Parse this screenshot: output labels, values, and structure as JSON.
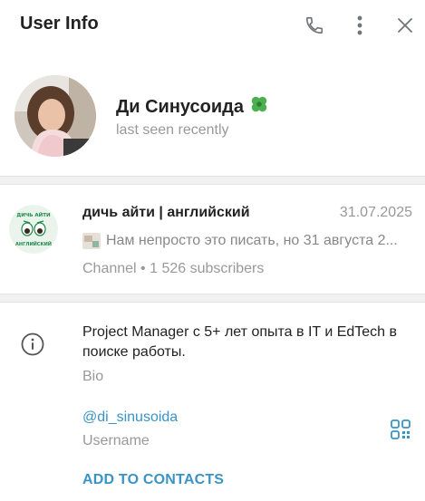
{
  "header": {
    "title": "User Info",
    "call_icon": "phone-icon",
    "more_icon": "more-vertical-icon",
    "close_icon": "close-icon"
  },
  "profile": {
    "name": "Ди Синусоида",
    "emoji_status": "🍀",
    "status": "last seen recently"
  },
  "channel": {
    "title": "дичь айти | английский",
    "date": "31.07.2025",
    "last_message": "Нам непросто это писать, но 31 августа 2...",
    "subscribers": "Channel • 1 526 subscribers",
    "avatar_text": "ДИЧЬ АЙТИ АНГЛИЙСКИЙ"
  },
  "info": {
    "bio": "Project Manager с 5+ лет опыта в IT и EdTech в поиске работы.",
    "bio_label": "Bio",
    "username": "@di_sinusoida",
    "username_label": "Username",
    "add_contacts": "ADD TO CONTACTS",
    "info_icon": "info-icon",
    "qr_icon": "qr-code-icon"
  },
  "colors": {
    "accent": "#3a93c6",
    "secondary_text": "#999999",
    "icon_gray": "#707579",
    "divider_bg": "#f1f1f1",
    "channel_avatar_green": "#1f8a4c"
  }
}
